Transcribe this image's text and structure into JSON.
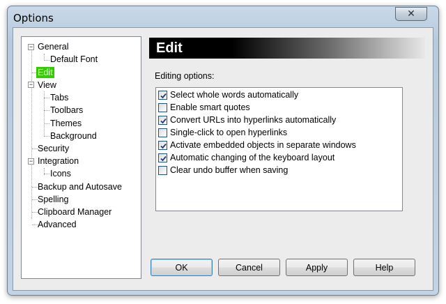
{
  "window": {
    "title": "Options",
    "close_glyph": "✕"
  },
  "tree": {
    "items": [
      {
        "label": "General",
        "expander": "−"
      },
      {
        "label": "Default Font"
      },
      {
        "label": "Edit",
        "selected": true
      },
      {
        "label": "View",
        "expander": "−"
      },
      {
        "label": "Tabs"
      },
      {
        "label": "Toolbars"
      },
      {
        "label": "Themes"
      },
      {
        "label": "Background"
      },
      {
        "label": "Security"
      },
      {
        "label": "Integration",
        "expander": "−"
      },
      {
        "label": "Icons"
      },
      {
        "label": "Backup and Autosave"
      },
      {
        "label": "Spelling"
      },
      {
        "label": "Clipboard Manager"
      },
      {
        "label": "Advanced"
      }
    ]
  },
  "panel": {
    "header": "Edit",
    "group_label": "Editing options:",
    "options": [
      {
        "label": "Select whole words automatically",
        "checked": true
      },
      {
        "label": "Enable smart quotes",
        "checked": false
      },
      {
        "label": "Convert URLs into hyperlinks automatically",
        "checked": true
      },
      {
        "label": "Single-click to open hyperlinks",
        "checked": false
      },
      {
        "label": "Activate embedded objects in separate windows",
        "checked": true
      },
      {
        "label": "Automatic changing of the keyboard layout",
        "checked": true
      },
      {
        "label": "Clear undo buffer when saving",
        "checked": false
      }
    ]
  },
  "buttons": {
    "ok": "OK",
    "cancel": "Cancel",
    "apply": "Apply",
    "help": "Help"
  },
  "colors": {
    "selection": "#33cc00",
    "header_bg": "#000000"
  }
}
